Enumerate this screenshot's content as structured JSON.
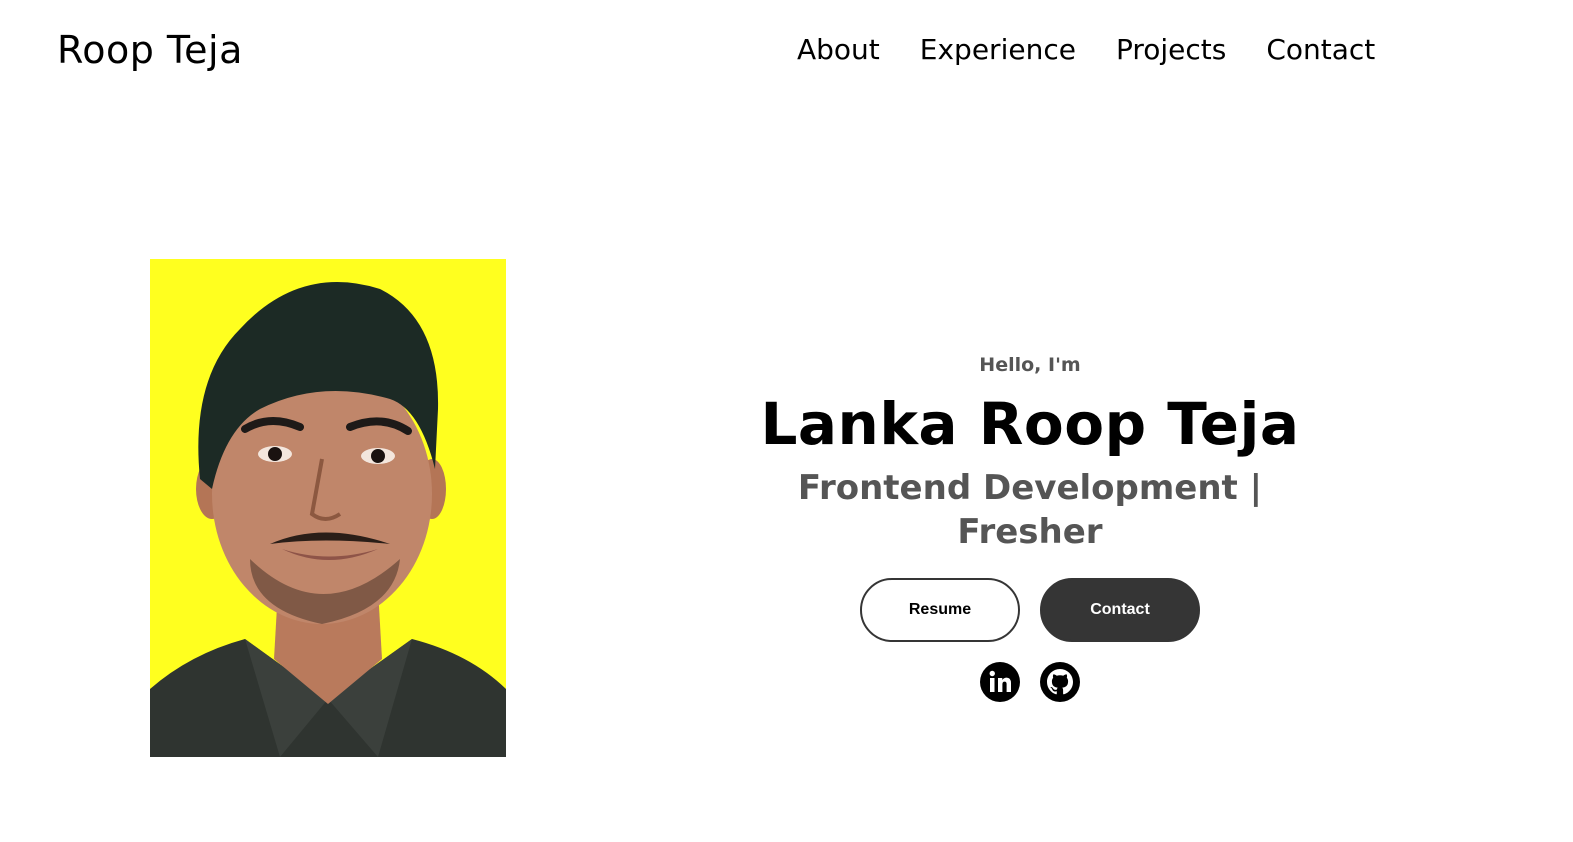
{
  "header": {
    "logo": "Roop Teja",
    "nav": [
      {
        "label": "About"
      },
      {
        "label": "Experience"
      },
      {
        "label": "Projects"
      },
      {
        "label": "Contact"
      }
    ]
  },
  "hero": {
    "greeting": "Hello, I'm",
    "name": "Lanka Roop Teja",
    "role": "Frontend Development | Fresher",
    "photo_alt": "profile-photo",
    "buttons": {
      "resume_label": "Resume",
      "contact_label": "Contact"
    },
    "socials": [
      {
        "icon": "linkedin-icon"
      },
      {
        "icon": "github-icon"
      }
    ]
  },
  "colors": {
    "background": "#ffffff",
    "photo_bg": "#ffff1f",
    "subtitle_gray": "#555555",
    "button_dark": "#353535"
  }
}
